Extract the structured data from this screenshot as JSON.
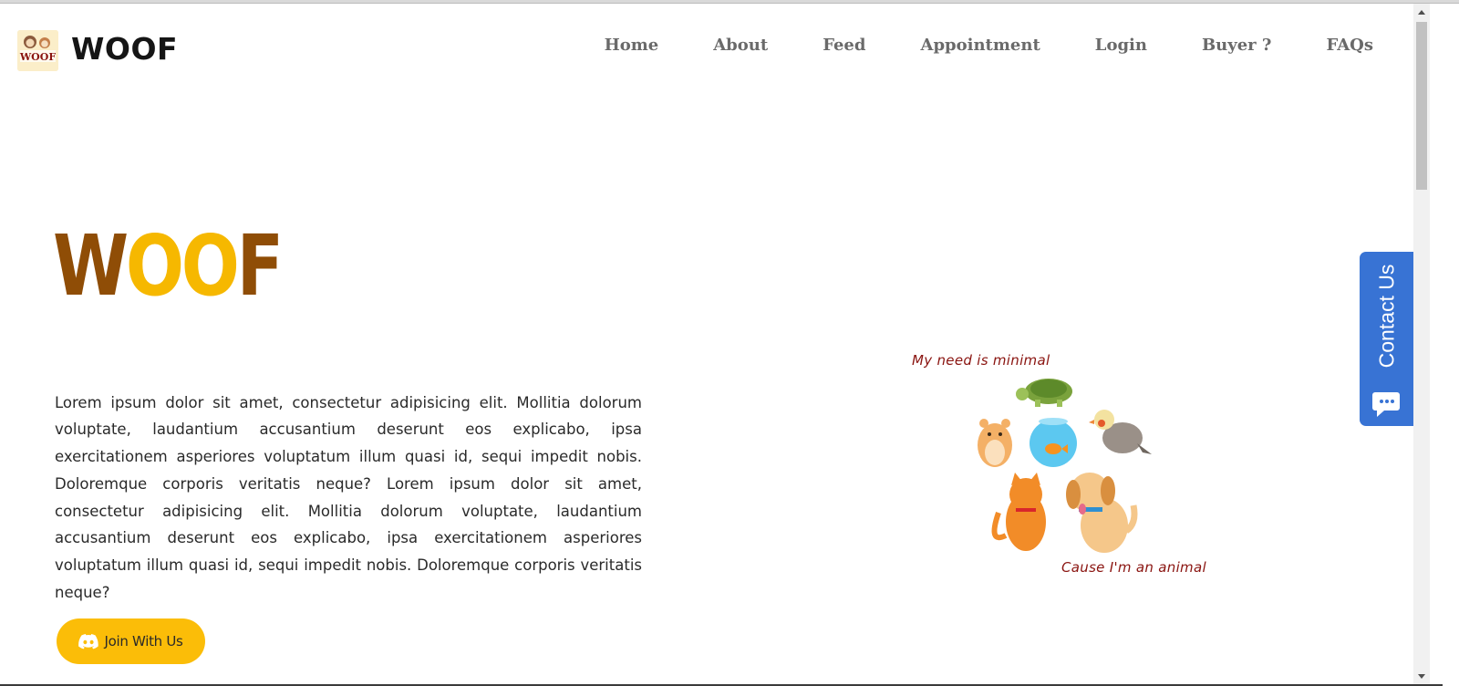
{
  "header": {
    "brand": "WOOF",
    "logo_text": "WOOF",
    "nav": [
      "Home",
      "About",
      "Feed",
      "Appointment",
      "Login",
      "Buyer ?",
      "FAQs"
    ]
  },
  "hero": {
    "title_parts": [
      "W",
      "OO",
      "F"
    ],
    "paragraph": "Lorem ipsum dolor sit amet, consectetur adipisicing elit. Mollitia dolorum voluptate, laudantium accusantium deserunt eos explicabo, ipsa exercitationem asperiores voluptatum illum quasi id, sequi impedit nobis. Doloremque corporis veritatis neque? Lorem ipsum dolor sit amet, consectetur adipisicing elit. Mollitia dolorum voluptate, laudantium accusantium deserunt eos explicabo, ipsa exercitationem asperiores voluptatum illum quasi id, sequi impedit nobis. Doloremque corporis veritatis neque?",
    "join_label": "Join With Us",
    "join_icon": "discord-icon"
  },
  "illustration": {
    "caption_top": "My need is minimal",
    "caption_bottom": "Cause I'm an animal"
  },
  "contact": {
    "label": "Contact Us",
    "icon": "chat-bubble-icon"
  },
  "colors": {
    "brown": "#8f4d06",
    "yellow": "#f6b800",
    "button": "#fbbd08",
    "contact_blue": "#3873d4",
    "caption_red": "#8a1410"
  }
}
